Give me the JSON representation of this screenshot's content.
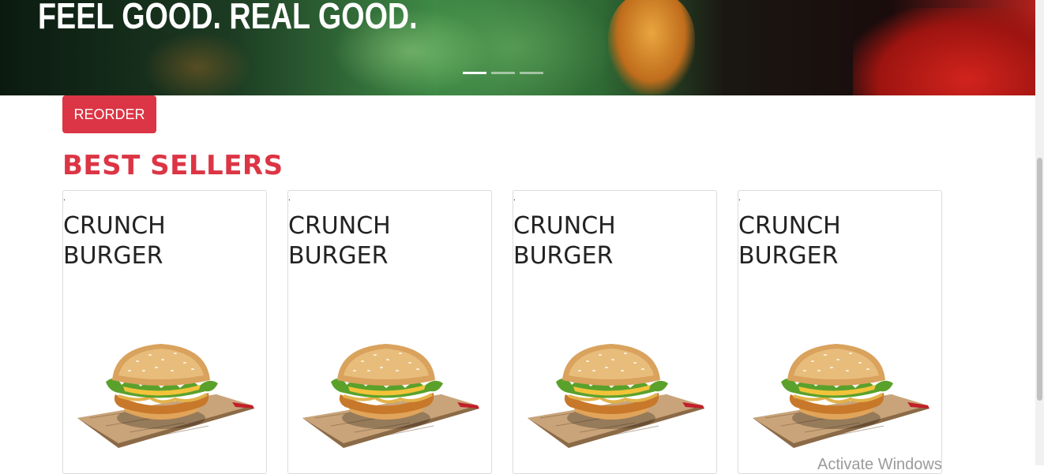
{
  "hero": {
    "title": "FEEL GOOD. REAL GOOD.",
    "slides": [
      {
        "active": true
      },
      {
        "active": false
      },
      {
        "active": false
      }
    ]
  },
  "actions": {
    "reorder_label": "REORDER"
  },
  "best_sellers": {
    "title": "BEST SELLERS",
    "items": [
      {
        "marker": ".",
        "name": "CRUNCH BURGER"
      },
      {
        "marker": ".",
        "name": "CRUNCH BURGER"
      },
      {
        "marker": ".",
        "name": "CRUNCH BURGER"
      },
      {
        "marker": ".",
        "name": "CRUNCH BURGER"
      }
    ]
  },
  "overlay": {
    "watermark": "Activate Windows"
  },
  "colors": {
    "accent": "#dc3545",
    "text": "#222222"
  }
}
